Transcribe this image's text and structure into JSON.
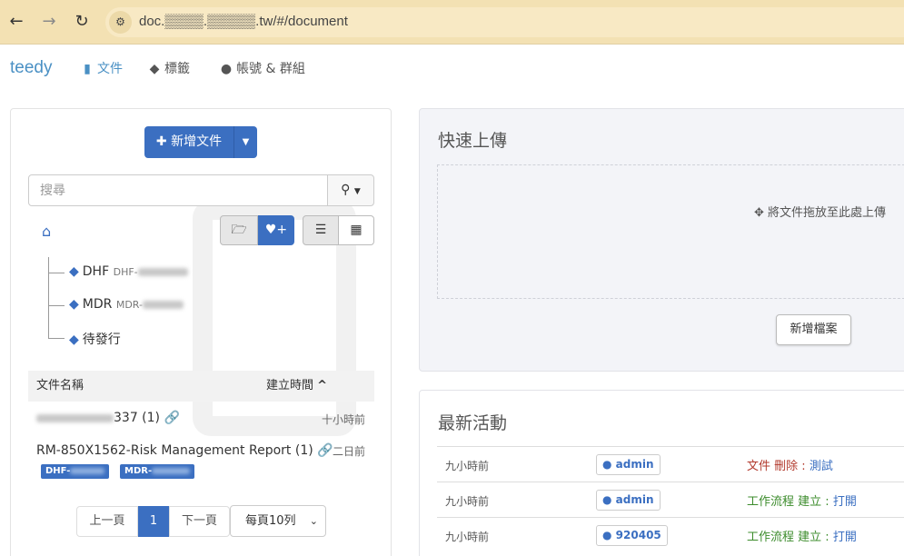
{
  "browser": {
    "back_icon": "arrow-left-icon",
    "forward_icon": "arrow-right-icon",
    "reload_icon": "reload-icon",
    "url": "doc.▒▒▒▒.▒▒▒▒▒.tw/#/document"
  },
  "app": {
    "brand": "teedy",
    "nav": {
      "documents": "文件",
      "tags": "標籤",
      "users_groups": "帳號 & 群組"
    }
  },
  "left": {
    "add_document": "新增文件",
    "search_placeholder": "搜尋",
    "tree": [
      {
        "label": "DHF",
        "sub": "DHF-"
      },
      {
        "label": "MDR",
        "sub": "MDR-"
      },
      {
        "label": "待發行",
        "sub": ""
      }
    ],
    "table": {
      "col_name": "文件名稱",
      "col_date": "建立時間"
    },
    "docs": [
      {
        "title": "337 (1)",
        "time": "十小時前",
        "tags": []
      },
      {
        "title": "RM-850X1562-Risk Management Report (1)",
        "time": "二日前",
        "tags": [
          "DHF-",
          "MDR-"
        ]
      }
    ],
    "pager": {
      "prev": "上一頁",
      "current": "1",
      "next": "下一頁",
      "page_size": "每頁10列"
    }
  },
  "upload": {
    "title": "快速上傳",
    "drop_text": "將文件拖放至此處上傳",
    "new_file": "新增檔案"
  },
  "activity": {
    "title": "最新活動",
    "rows": [
      {
        "time": "九小時前",
        "user": "admin",
        "type": "文件",
        "action": "刪除 :",
        "target": "測試"
      },
      {
        "time": "九小時前",
        "user": "admin",
        "type": "工作流程",
        "action": "建立 :",
        "target": "打開"
      },
      {
        "time": "九小時前",
        "user": "920405",
        "type": "工作流程",
        "action": "建立 :",
        "target": "打開"
      }
    ]
  },
  "colors": {
    "accent": "#3b6fc1",
    "brand": "#4a90c4",
    "chrome": "#f3e1b3",
    "delete": "#b23a2d",
    "create": "#3c8c2c"
  }
}
